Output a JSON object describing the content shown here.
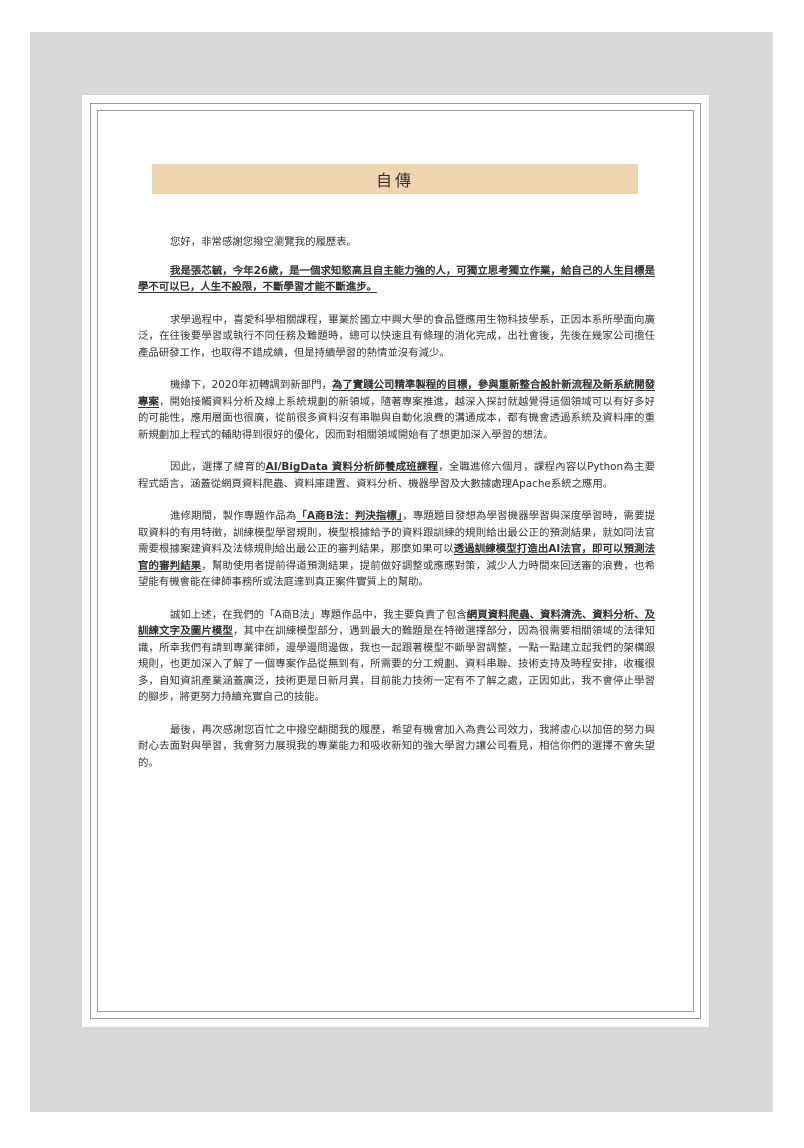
{
  "document": {
    "title": "自傳",
    "greeting": "您好，非常感謝您撥空瀏覽我的履歷表。",
    "intro": "我是張芯毓，今年26歲，是一個求知慾高且自主能力強的人，可獨立思考獨立作業，給自己的人生目標是學不可以已，人生不設限，不斷學習才能不斷進步。",
    "p1": "求學過程中，喜愛科學相關課程，畢業於國立中興大學的食品暨應用生物科技學系，正因本系所學面向廣泛，在往後要學習或執行不同任務及難題時，總可以快速且有條理的消化完成，出社會後，先後在幾家公司擔任產品研發工作，也取得不錯成績，但是持續學習的熱情並沒有減少。",
    "p2_a": "機緣下，2020年初轉調到新部門，",
    "p2_b": "為了實踐公司精準製程的目標，參與重新整合設計新流程及新系統開發專案",
    "p2_c": "，開始接觸資料分析及線上系統規劃的新領域，隨著專案推進，越深入探討就越覺得這個領域可以有好多好的可能性，應用層面也很廣，從前很多資料沒有串聯與自動化浪費的溝通成本，都有機會透過系統及資料庫的重新規劃加上程式的輔助得到很好的優化，因而對相關領域開始有了想更加深入學習的想法。",
    "p3_a": "因此，選擇了緯育的",
    "p3_b": "AI/BigData 資料分析師養成班課程",
    "p3_c": "，全職進修六個月，課程內容以Python為主要程式語言，涵蓋從網頁資料爬蟲、資料庫建置、資料分析、機器學習及大數據處理Apache系統之應用。",
    "p4_a": "進修期間，製作專題作品為",
    "p4_b": "「A商B法：判決指標」",
    "p4_c": "，專題題目發想為學習機器學習與深度學習時，需要提取資料的有用特徵，訓練模型學習規則，模型根據給予的資料跟訓練的規則給出最公正的預測結果，就如同法官需要根據案建資料及法條規則給出最公正的審判結果，那麼如果可以",
    "p4_d": "透過訓練模型打造出AI法官，即可以預測法官的審判結果",
    "p4_e": "，幫助使用者提前得道預測結果，提前做好調整或應應對策，減少人力時間來回送審的浪費，也希望能有機會能在律師事務所或法庭達到真正案件實質上的幫助。",
    "p5_a": "誠如上述，在我們的「A商B法」專題作品中，我主要負責了包含",
    "p5_b": "網頁資料爬蟲、資料清洗、資料分析、及訓練文字及圖片模型",
    "p5_c": "，其中在訓練模型部分，遇到最大的難題是在特徵選擇部分，因為很需要相關領域的法律知識，所幸我們有請到專業律師，邊學邊問邊做，我也一起跟著模型不斷學習調整，一點一點建立起我們的架構跟規則，也更加深入了解了一個專案作品從無到有，所需要的分工規劃、資料串聯、技術支持及時程安排，收穫很多，自知資訊產業涵蓋廣泛，技術更是日新月異，目前能力技術一定有不了解之處，正因如此，我不會停止學習的腳步，將更努力持續充實自己的技能。",
    "p6": "最後，再次感謝您百忙之中撥空翻閱我的履歷，希望有機會加入為貴公司效力，我將虛心以加倍的努力與耐心去面對與學習，我會努力展現我的專業能力和吸收新知的強大學習力讓公司看見，相信你們的選擇不會失望的。"
  },
  "colors": {
    "background": "#d9d9d9",
    "title_bar": "#f0d5b1",
    "text": "#333333",
    "frame": "#9a9a9a"
  }
}
